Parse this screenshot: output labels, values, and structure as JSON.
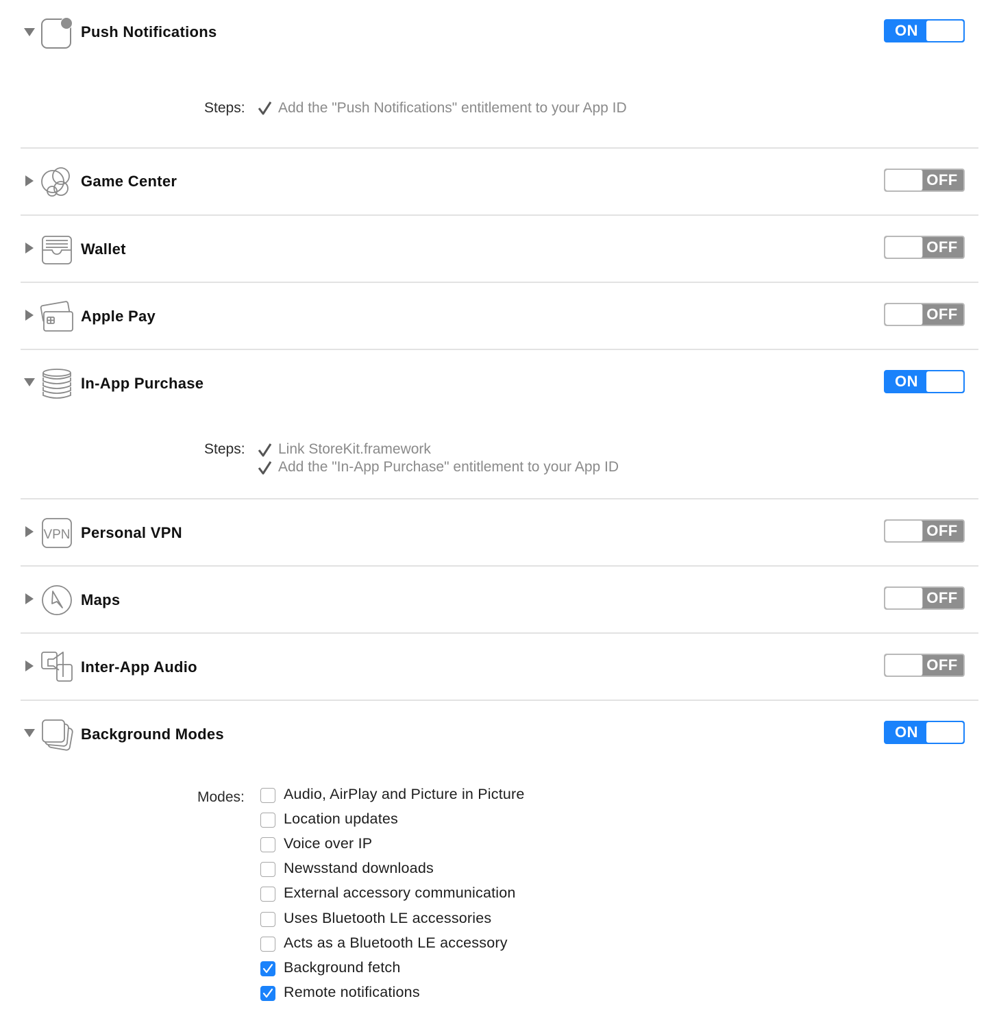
{
  "capabilities": [
    {
      "title": "Push Notifications",
      "state": "ON",
      "expanded": true,
      "icon": "push-notifications-icon",
      "steps_label": "Steps:",
      "steps": [
        "Add the \"Push Notifications\" entitlement to your App ID"
      ]
    },
    {
      "title": "Game Center",
      "state": "OFF",
      "expanded": false,
      "icon": "game-center-icon"
    },
    {
      "title": "Wallet",
      "state": "OFF",
      "expanded": false,
      "icon": "wallet-icon"
    },
    {
      "title": "Apple Pay",
      "state": "OFF",
      "expanded": false,
      "icon": "apple-pay-icon"
    },
    {
      "title": "In-App Purchase",
      "state": "ON",
      "expanded": true,
      "icon": "in-app-purchase-icon",
      "steps_label": "Steps:",
      "steps": [
        "Link StoreKit.framework",
        "Add the \"In-App Purchase\" entitlement to your App ID"
      ]
    },
    {
      "title": "Personal VPN",
      "state": "OFF",
      "expanded": false,
      "icon": "personal-vpn-icon",
      "icon_text": "VPN"
    },
    {
      "title": "Maps",
      "state": "OFF",
      "expanded": false,
      "icon": "maps-icon"
    },
    {
      "title": "Inter-App Audio",
      "state": "OFF",
      "expanded": false,
      "icon": "inter-app-audio-icon"
    },
    {
      "title": "Background Modes",
      "state": "ON",
      "expanded": true,
      "icon": "background-modes-icon",
      "modes_label": "Modes:",
      "modes": [
        {
          "label": "Audio, AirPlay and Picture in Picture",
          "checked": false
        },
        {
          "label": "Location updates",
          "checked": false
        },
        {
          "label": "Voice over IP",
          "checked": false
        },
        {
          "label": "Newsstand downloads",
          "checked": false
        },
        {
          "label": "External accessory communication",
          "checked": false
        },
        {
          "label": "Uses Bluetooth LE accessories",
          "checked": false
        },
        {
          "label": "Acts as a Bluetooth LE accessory",
          "checked": false
        },
        {
          "label": "Background fetch",
          "checked": true
        },
        {
          "label": "Remote notifications",
          "checked": true
        }
      ]
    }
  ],
  "colors": {
    "accent": "#1a82fb",
    "toggle_off": "#8e8e8e",
    "divider": "#e2e2e2",
    "step_text": "#8a8a8a"
  }
}
